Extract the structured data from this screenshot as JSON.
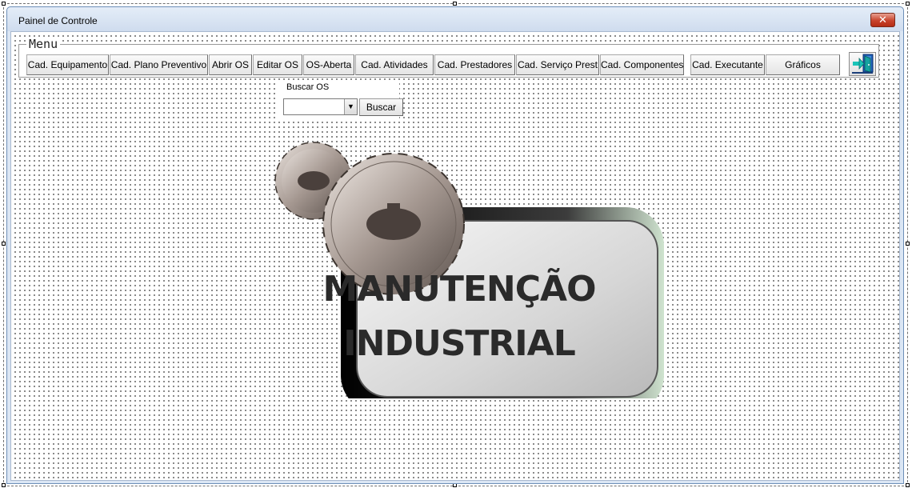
{
  "window": {
    "title": "Painel de Controle",
    "close_symbol": "✕"
  },
  "menu": {
    "legend": "Menu",
    "buttons": [
      "Cad. Equipamento",
      "Cad. Plano Preventivo",
      "Abrir OS",
      "Editar OS",
      "OS-Aberta",
      "Cad. Atividades",
      "Cad. Prestadores",
      "Cad. Serviço Prest",
      "Cad. Componentes",
      "Cad. Executante",
      "Gráficos"
    ],
    "exit_icon": "exit-door-icon"
  },
  "search": {
    "legend": "Buscar OS",
    "value": "",
    "button_label": "Buscar"
  },
  "logo": {
    "line1": "MANUTENÇÃO",
    "line2": "INDUSTRIAL"
  },
  "colors": {
    "accent": "#dbe6f4",
    "close": "#c8432c"
  }
}
